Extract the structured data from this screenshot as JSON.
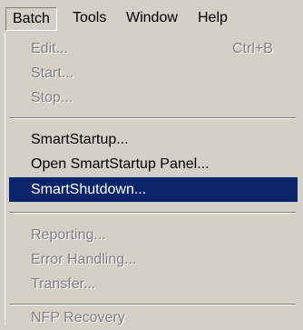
{
  "menubar": {
    "items": [
      {
        "label": "Batch"
      },
      {
        "label": "Tools"
      },
      {
        "label": "Window"
      },
      {
        "label": "Help"
      }
    ]
  },
  "batch_menu": {
    "items": [
      {
        "label": "Edit...",
        "shortcut": "Ctrl+B",
        "enabled": false
      },
      {
        "label": "Start...",
        "enabled": false
      },
      {
        "label": "Stop...",
        "enabled": false
      },
      {
        "label": "SmartStartup...",
        "enabled": true
      },
      {
        "label": "Open SmartStartup Panel...",
        "enabled": true
      },
      {
        "label": "SmartShutdown...",
        "enabled": true,
        "highlighted": true
      },
      {
        "label": "Reporting...",
        "enabled": false
      },
      {
        "label": "Error Handling...",
        "enabled": false
      },
      {
        "label": "Transfer...",
        "enabled": false
      },
      {
        "label": "NFP Recovery",
        "enabled": false
      }
    ]
  },
  "colors": {
    "menu_background": "#d4d0c8",
    "highlight_background": "#0a246a",
    "highlight_text": "#ffffff",
    "disabled_text": "#808080"
  }
}
